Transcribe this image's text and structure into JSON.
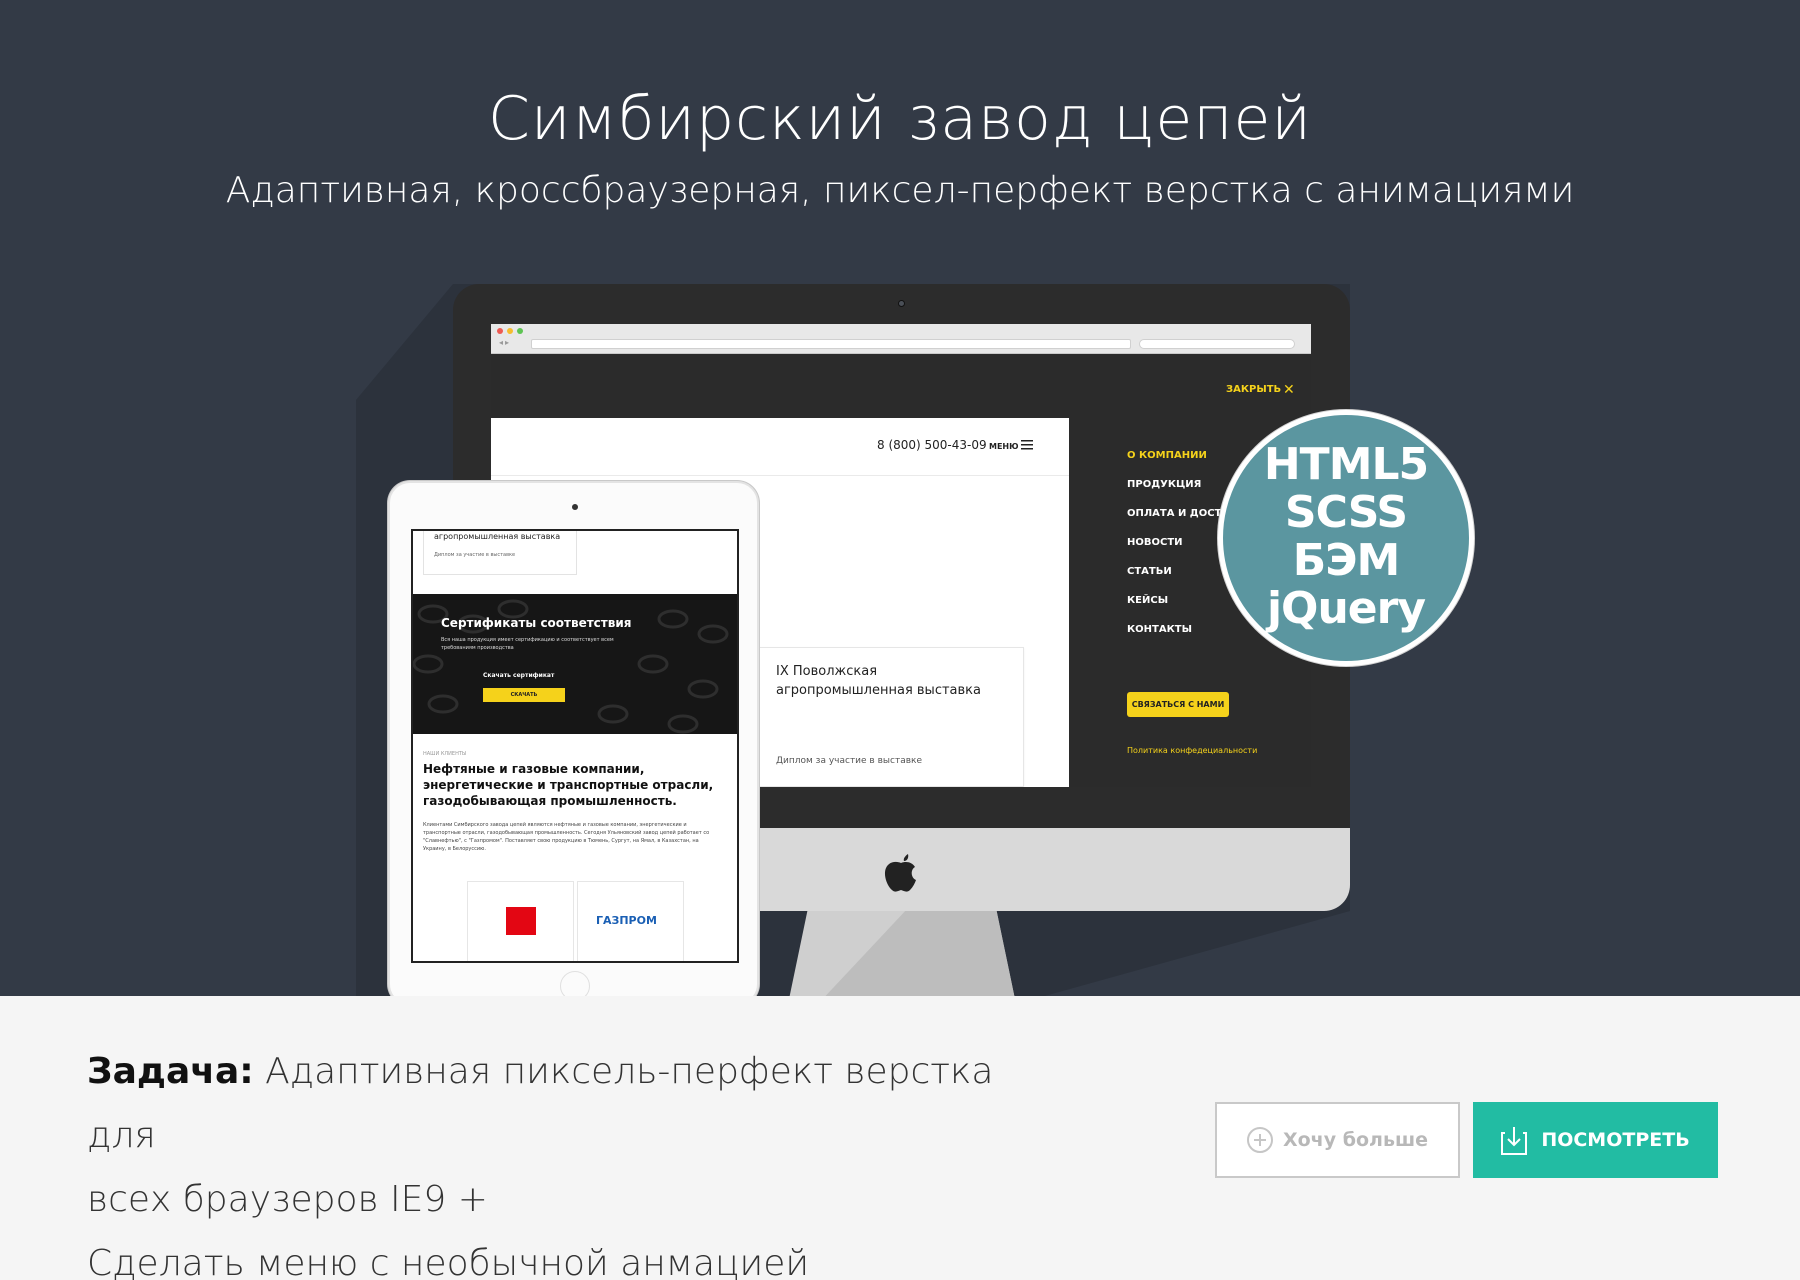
{
  "hero": {
    "title": "Симбирский завод цепей",
    "subtitle": "Адаптивная, кроссбраузерная, пиксел-перфект верстка с анимациями"
  },
  "desktop_site": {
    "close_label": "ЗАКРЫТЬ",
    "phone": "8 (800) 500-43-09",
    "menu_label": "МЕНЮ",
    "news_title": "IX Поволжская агропромышленная выставка",
    "news_note": "Диплом за участие в выставке",
    "menu_items": [
      "О КОМПАНИИ",
      "ПРОДУКЦИЯ",
      "ОПЛАТА И ДОСТАВ",
      "НОВОСТИ",
      "СТАТЬИ",
      "КЕЙСЫ",
      "КОНТАКТЫ"
    ],
    "contact_button": "СВЯЗАТЬСЯ С НАМИ",
    "privacy_link": "Политика конфедециальности"
  },
  "tablet_site": {
    "card_title": "агропромышленная выставка",
    "card_note": "Диплом за участие в выставке",
    "cert_title": "Сертификаты соответствия",
    "cert_text": "Вся наша продукция имеет сертификацию и соответствует всем требованиям производства",
    "cert_download": "Скачать сертификат",
    "cert_button": "СКАЧАТЬ",
    "clients_label": "НАШИ КЛИЕНТЫ",
    "clients_title": "Нефтяные и газовые компании, энергетические и транспортные отрасли, газодобывающая промышленность.",
    "clients_text": "Клиентами Симбирского завода цепей являются нефтяные и газовые компании, энергетические и транспортные отрасли, газодобывающая промышленность. Сегодня Ульяновский завод цепей работает со \"Славнефтью\", с \"Газпромом\". Поставляет свою продукцию в Тюмень, Сургут, на Ямал, в Казахстан, на Украину, в Белоруссию.",
    "gazprom_logo": "ГАЗПРОМ"
  },
  "badge": {
    "lines": [
      "HTML5",
      "SCSS",
      "БЭМ",
      "jQuery"
    ],
    "color": "#5b96a0"
  },
  "task": {
    "label": "Задача:",
    "line1": "Адаптивная пиксель-перфект верстка для",
    "line2": "всех браузеров IE9 +",
    "line3": "Сделать меню с необычной анмацией"
  },
  "buttons": {
    "more": "Хочу больше",
    "view": "ПОСМОТРЕТЬ"
  },
  "colors": {
    "hero_bg": "#333a46",
    "accent_yellow": "#f5d21b",
    "view_button": "#22bca3"
  }
}
